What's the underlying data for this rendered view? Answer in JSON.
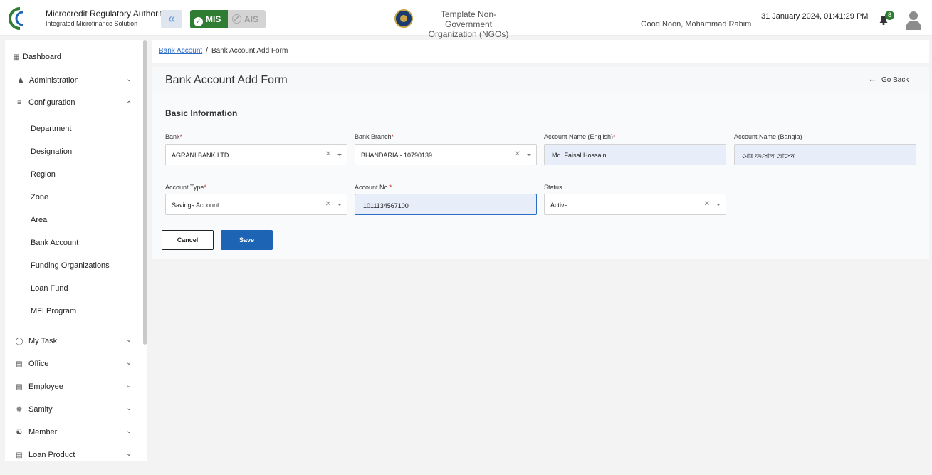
{
  "header": {
    "org_name": "Microcredit Regulatory Authority",
    "org_subtitle": "Integrated Microfinance Solution",
    "logo_text": "Microcredit Regulatory Authority",
    "mode_mis": "MIS",
    "mode_ais": "AIS",
    "template_name_line1": "Template Non-Government",
    "template_name_line2": "Organization (NGOs)",
    "greeting": "Good Noon, Mohammad Rahim",
    "datetime": "31 January 2024, 01:41:29 PM",
    "notification_count": "8",
    "colors": {
      "brand_green": "#2e7d32",
      "primary_blue": "#1d64b4"
    }
  },
  "sidebar": {
    "items": [
      {
        "label": "Dashboard",
        "icon": "grid-icon"
      },
      {
        "label": "Administration",
        "icon": "users-icon",
        "expandable": true
      },
      {
        "label": "Configuration",
        "icon": "sliders-icon",
        "expanded": true
      },
      {
        "label": "My Task",
        "icon": "circle-dashed-icon",
        "expandable": true
      },
      {
        "label": "Office",
        "icon": "office-icon",
        "expandable": true
      },
      {
        "label": "Employee",
        "icon": "employee-icon",
        "expandable": true
      },
      {
        "label": "Samity",
        "icon": "group-icon",
        "expandable": true
      },
      {
        "label": "Member",
        "icon": "member-icon",
        "expandable": true
      },
      {
        "label": "Loan Product",
        "icon": "loan-product-icon",
        "expandable": true
      }
    ],
    "configuration_children": [
      "Department",
      "Designation",
      "Region",
      "Zone",
      "Area",
      "Bank Account",
      "Funding Organizations",
      "Loan Fund",
      "MFI Program"
    ]
  },
  "breadcrumb": {
    "parent": "Bank Account",
    "current": "Bank Account Add Form"
  },
  "page": {
    "title": "Bank Account Add Form",
    "go_back": "Go Back"
  },
  "form": {
    "section_title": "Basic Information",
    "fields": {
      "bank": {
        "label": "Bank",
        "value": "AGRANI BANK LTD."
      },
      "bank_branch": {
        "label": "Bank Branch",
        "value": "BHANDARIA - 10790139"
      },
      "account_name_en": {
        "label": "Account Name (English)",
        "value": "Md. Faisal Hossain"
      },
      "account_name_bn": {
        "label": "Account Name (Bangla)",
        "value": "মোঃ ফয়সাল হোসেন"
      },
      "account_type": {
        "label": "Account Type",
        "value": "Savings Account"
      },
      "account_no": {
        "label": "Account No.",
        "value": "1011134567100"
      },
      "status": {
        "label": "Status",
        "value": "Active"
      }
    },
    "cancel_label": "Cancel",
    "save_label": "Save"
  }
}
